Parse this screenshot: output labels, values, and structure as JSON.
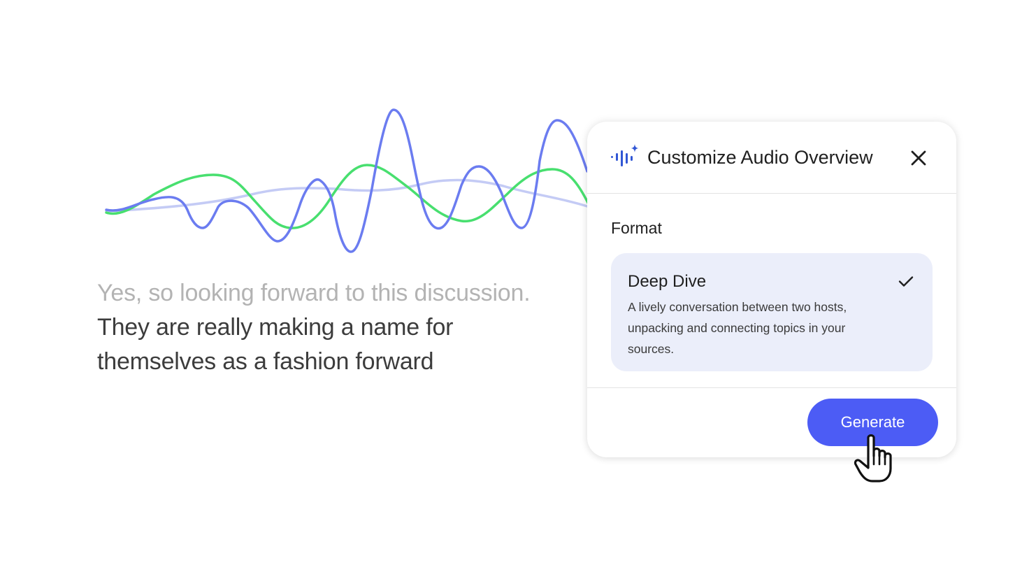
{
  "transcript": {
    "lines": [
      "Yes, so looking forward to this discussion.",
      "They are really making a name for",
      "themselves as a fashion forward"
    ]
  },
  "panel": {
    "title": "Customize Audio Overview",
    "header_icon": "audio-sparkle-icon",
    "close_icon": "close-icon",
    "section_label": "Format",
    "format_option": {
      "name": "Deep Dive",
      "description": "A lively conversation between two hosts, unpacking and connecting topics in your sources.",
      "selected": true
    },
    "generate_label": "Generate"
  },
  "colors": {
    "wave_primary": "#6b7cf0",
    "wave_secondary": "#48df6f",
    "wave_faded": "#c4cbf5",
    "accent": "#4c5cf5",
    "card_bg": "#ebeefa"
  }
}
